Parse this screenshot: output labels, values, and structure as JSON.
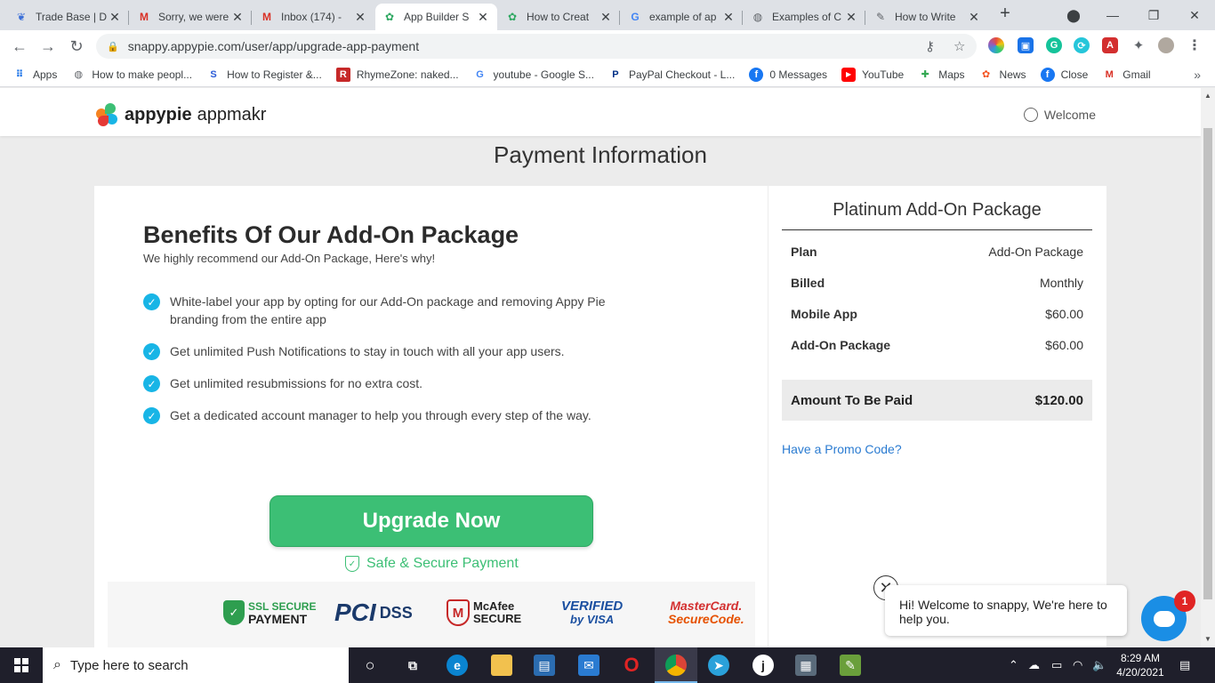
{
  "browser": {
    "tabs": [
      {
        "title": "Trade Base | D",
        "icon": "tradebase-icon"
      },
      {
        "title": "Sorry, we were",
        "icon": "gmail-icon"
      },
      {
        "title": "Inbox (174) -",
        "icon": "gmail-icon"
      },
      {
        "title": "App Builder S",
        "icon": "appypie-icon"
      },
      {
        "title": "How to Creat",
        "icon": "appypie-icon"
      },
      {
        "title": "example of ap",
        "icon": "google-icon"
      },
      {
        "title": "Examples of C",
        "icon": "globe-icon"
      },
      {
        "title": "How to Write",
        "icon": "feather-icon"
      }
    ],
    "url": "snappy.appypie.com/user/app/upgrade-app-payment",
    "bookmarks": [
      {
        "label": "Apps"
      },
      {
        "label": "How to make peopl..."
      },
      {
        "label": "How to Register &..."
      },
      {
        "label": "RhymeZone: naked..."
      },
      {
        "label": "youtube - Google S..."
      },
      {
        "label": "PayPal Checkout - L..."
      },
      {
        "label": "0 Messages"
      },
      {
        "label": "YouTube"
      },
      {
        "label": "Maps"
      },
      {
        "label": "News"
      },
      {
        "label": "Close"
      },
      {
        "label": "Gmail"
      }
    ]
  },
  "header": {
    "brand_primary": "appypie",
    "brand_secondary": "appmakr",
    "welcome": "Welcome"
  },
  "page_title": "Payment Information",
  "benefits": {
    "title": "Benefits Of Our Add-On Package",
    "subtitle": "We highly recommend our Add-On Package, Here's why!",
    "items": [
      "White-label your app by opting for our Add-On package and removing Appy Pie branding from the entire app",
      "Get unlimited Push Notifications to stay in touch with all your app users.",
      "Get unlimited resubmissions for no extra cost.",
      "Get a dedicated account manager to help you through every step of the way."
    ],
    "upgrade_label": "Upgrade Now",
    "secure_label": "Safe & Secure Payment",
    "badges": {
      "ssl_line1": "SSL SECURE",
      "ssl_line2": "PAYMENT",
      "pci": "PCI",
      "pci_dss": "DSS",
      "mcafee_line1": "McAfee",
      "mcafee_line2": "SECURE",
      "visa_line1": "VERIFIED",
      "visa_line2": "by VISA",
      "mc_line1": "MasterCard.",
      "mc_line2": "SecureCode."
    }
  },
  "summary": {
    "title": "Platinum Add-On Package",
    "rows": [
      {
        "label": "Plan",
        "value": "Add-On Package"
      },
      {
        "label": "Billed",
        "value": "Monthly"
      },
      {
        "label": "Mobile App",
        "value": "$60.00"
      },
      {
        "label": "Add-On Package",
        "value": "$60.00"
      }
    ],
    "total_label": "Amount To Be Paid",
    "total_value": "$120.00",
    "promo_label": "Have a Promo Code?"
  },
  "chat": {
    "message": "Hi! Welcome to snappy, We're here to help you.",
    "badge_count": "1"
  },
  "taskbar": {
    "search_placeholder": "Type here to search",
    "time": "8:29 AM",
    "date": "4/20/2021"
  },
  "colors": {
    "accent_green": "#3cbf75",
    "check_blue": "#18b5e6",
    "link_blue": "#2a7bd1",
    "chat_blue": "#1a8ee5"
  }
}
